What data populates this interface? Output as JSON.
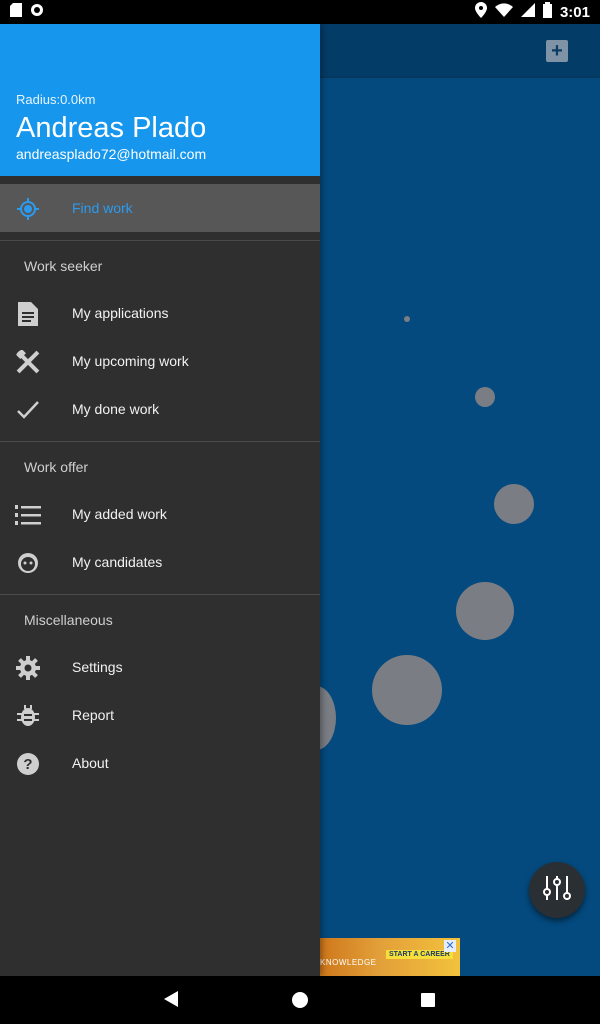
{
  "status_bar": {
    "time": "3:01"
  },
  "drawer": {
    "header": {
      "radius": "Radius:0.0km",
      "name": "Andreas Plado",
      "email": "andreasplado72@hotmail.com"
    },
    "find_work": {
      "label": "Find work",
      "icon": "crosshair-icon"
    },
    "sections": {
      "work_seeker": {
        "title": "Work seeker",
        "items": [
          {
            "label": "My applications",
            "icon": "document-icon"
          },
          {
            "label": "My upcoming work",
            "icon": "tools-icon"
          },
          {
            "label": "My done work",
            "icon": "checkmark-icon"
          }
        ]
      },
      "work_offer": {
        "title": "Work offer",
        "items": [
          {
            "label": "My added work",
            "icon": "numbered-list-icon"
          },
          {
            "label": "My candidates",
            "icon": "face-icon"
          }
        ]
      },
      "misc": {
        "title": "Miscellaneous",
        "items": [
          {
            "label": "Settings",
            "icon": "gear-icon"
          },
          {
            "label": "Report",
            "icon": "bug-icon"
          },
          {
            "label": "About",
            "icon": "help-icon"
          }
        ]
      }
    }
  },
  "ad": {
    "text": "KNOWLEDGE",
    "cta": "START A CAREER"
  },
  "colors": {
    "drawer_header": "#1696ec",
    "drawer_bg": "#2f2f2f",
    "active_item": "#575757",
    "accent": "#2b9bf0",
    "map_bg": "#044a7e"
  }
}
